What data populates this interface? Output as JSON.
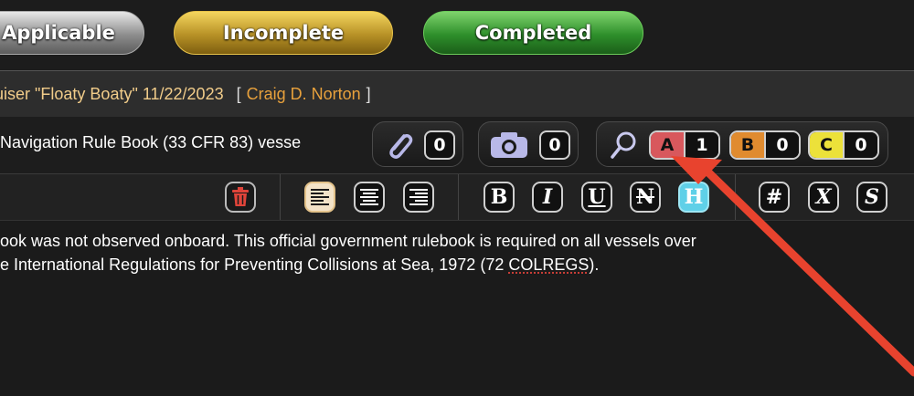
{
  "status_buttons": {
    "applicable": "Applicable",
    "incomplete": "Incomplete",
    "completed": "Completed"
  },
  "inspection": {
    "title_fragment": "uiser \"Floaty Boaty\" 11/22/2023",
    "bracket_open": "[",
    "inspector": "Craig D. Norton",
    "bracket_close": "]"
  },
  "finding": {
    "title_fragment": "Navigation Rule Book (33 CFR 83) vesse",
    "attachments_count": "0",
    "photos_count": "0",
    "severity": [
      {
        "letter": "A",
        "count": "1",
        "color": "#d8585d"
      },
      {
        "letter": "B",
        "count": "0",
        "color": "#e08b2f"
      },
      {
        "letter": "C",
        "count": "0",
        "color": "#ece13a"
      }
    ],
    "icons": {
      "attachments": "paperclip-icon",
      "photos": "camera-icon",
      "search": "magnifier-icon"
    }
  },
  "toolbar": {
    "bold": "B",
    "italic": "I",
    "underline": "U",
    "strike": "N",
    "highlight": "H",
    "hash": "#",
    "clear_format": "X",
    "special": "S"
  },
  "editor": {
    "line1": "ook was not observed onboard. This official government rulebook is required on all vessels over",
    "line2_before": "e International Regulations for Preventing Collisions at Sea, 1972 (72 ",
    "line2_misspelled": "COLREGS",
    "line2_after": ")."
  },
  "colors": {
    "annotation_arrow": "#e8432e",
    "inspector_name": "#e8a13c",
    "inspection_title": "#f1cc8a"
  }
}
